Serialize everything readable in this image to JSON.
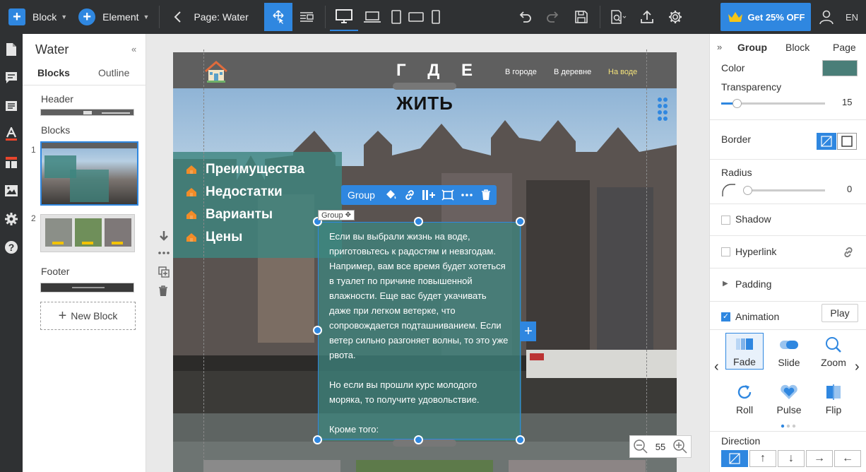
{
  "topbar": {
    "block_label": "Block",
    "element_label": "Element",
    "page_label": "Page: Water",
    "promo_label": "Get 25% OFF",
    "language": "EN"
  },
  "left_panel": {
    "title": "Water",
    "tabs": {
      "blocks": "Blocks",
      "outline": "Outline"
    },
    "header_label": "Header",
    "blocks_label": "Blocks",
    "footer_label": "Footer",
    "block_numbers": [
      "1",
      "2"
    ],
    "new_block_label": "New Block"
  },
  "site": {
    "title": "Г Д Е",
    "hero_title": "ЖИТЬ",
    "nav": [
      "В городе",
      "В деревне",
      "На воде"
    ],
    "features": [
      "Преимущества",
      "Недостатки",
      "Варианты",
      "Цены"
    ],
    "paragraphs": [
      "Если вы выбрали жизнь на воде, приготовьтесь к радостям и невзгодам. Например, вам все время будет хотеться в туалет по причине повышенной влажности. Еще вас будет укачивать даже при легком ветерке, что сопровождается подташниванием. Если ветер сильно разгоняет волны, то это уже рвота.",
      "Но если вы прошли курс молодого моряка, то получите удовольствие.",
      "Кроме того:"
    ]
  },
  "selection": {
    "toolbar_label": "Group",
    "tag_label": "Group"
  },
  "zoom": {
    "value": "55"
  },
  "props": {
    "tabs": [
      "Group",
      "Block",
      "Page"
    ],
    "color_label": "Color",
    "color_value": "#4a7e78",
    "transparency_label": "Transparency",
    "transparency_value": "15",
    "transparency_fraction": 0.15,
    "border_label": "Border",
    "radius_label": "Radius",
    "radius_value": "0",
    "shadow_label": "Shadow",
    "hyperlink_label": "Hyperlink",
    "padding_label": "Padding",
    "animation_label": "Animation",
    "play_label": "Play",
    "animations": [
      "Fade",
      "Slide",
      "Zoom",
      "Roll",
      "Pulse",
      "Flip"
    ],
    "direction_label": "Direction"
  },
  "colors": {
    "accent": "#2f87e0",
    "toolbar": "#2f3133",
    "teal": "#3e857f"
  }
}
